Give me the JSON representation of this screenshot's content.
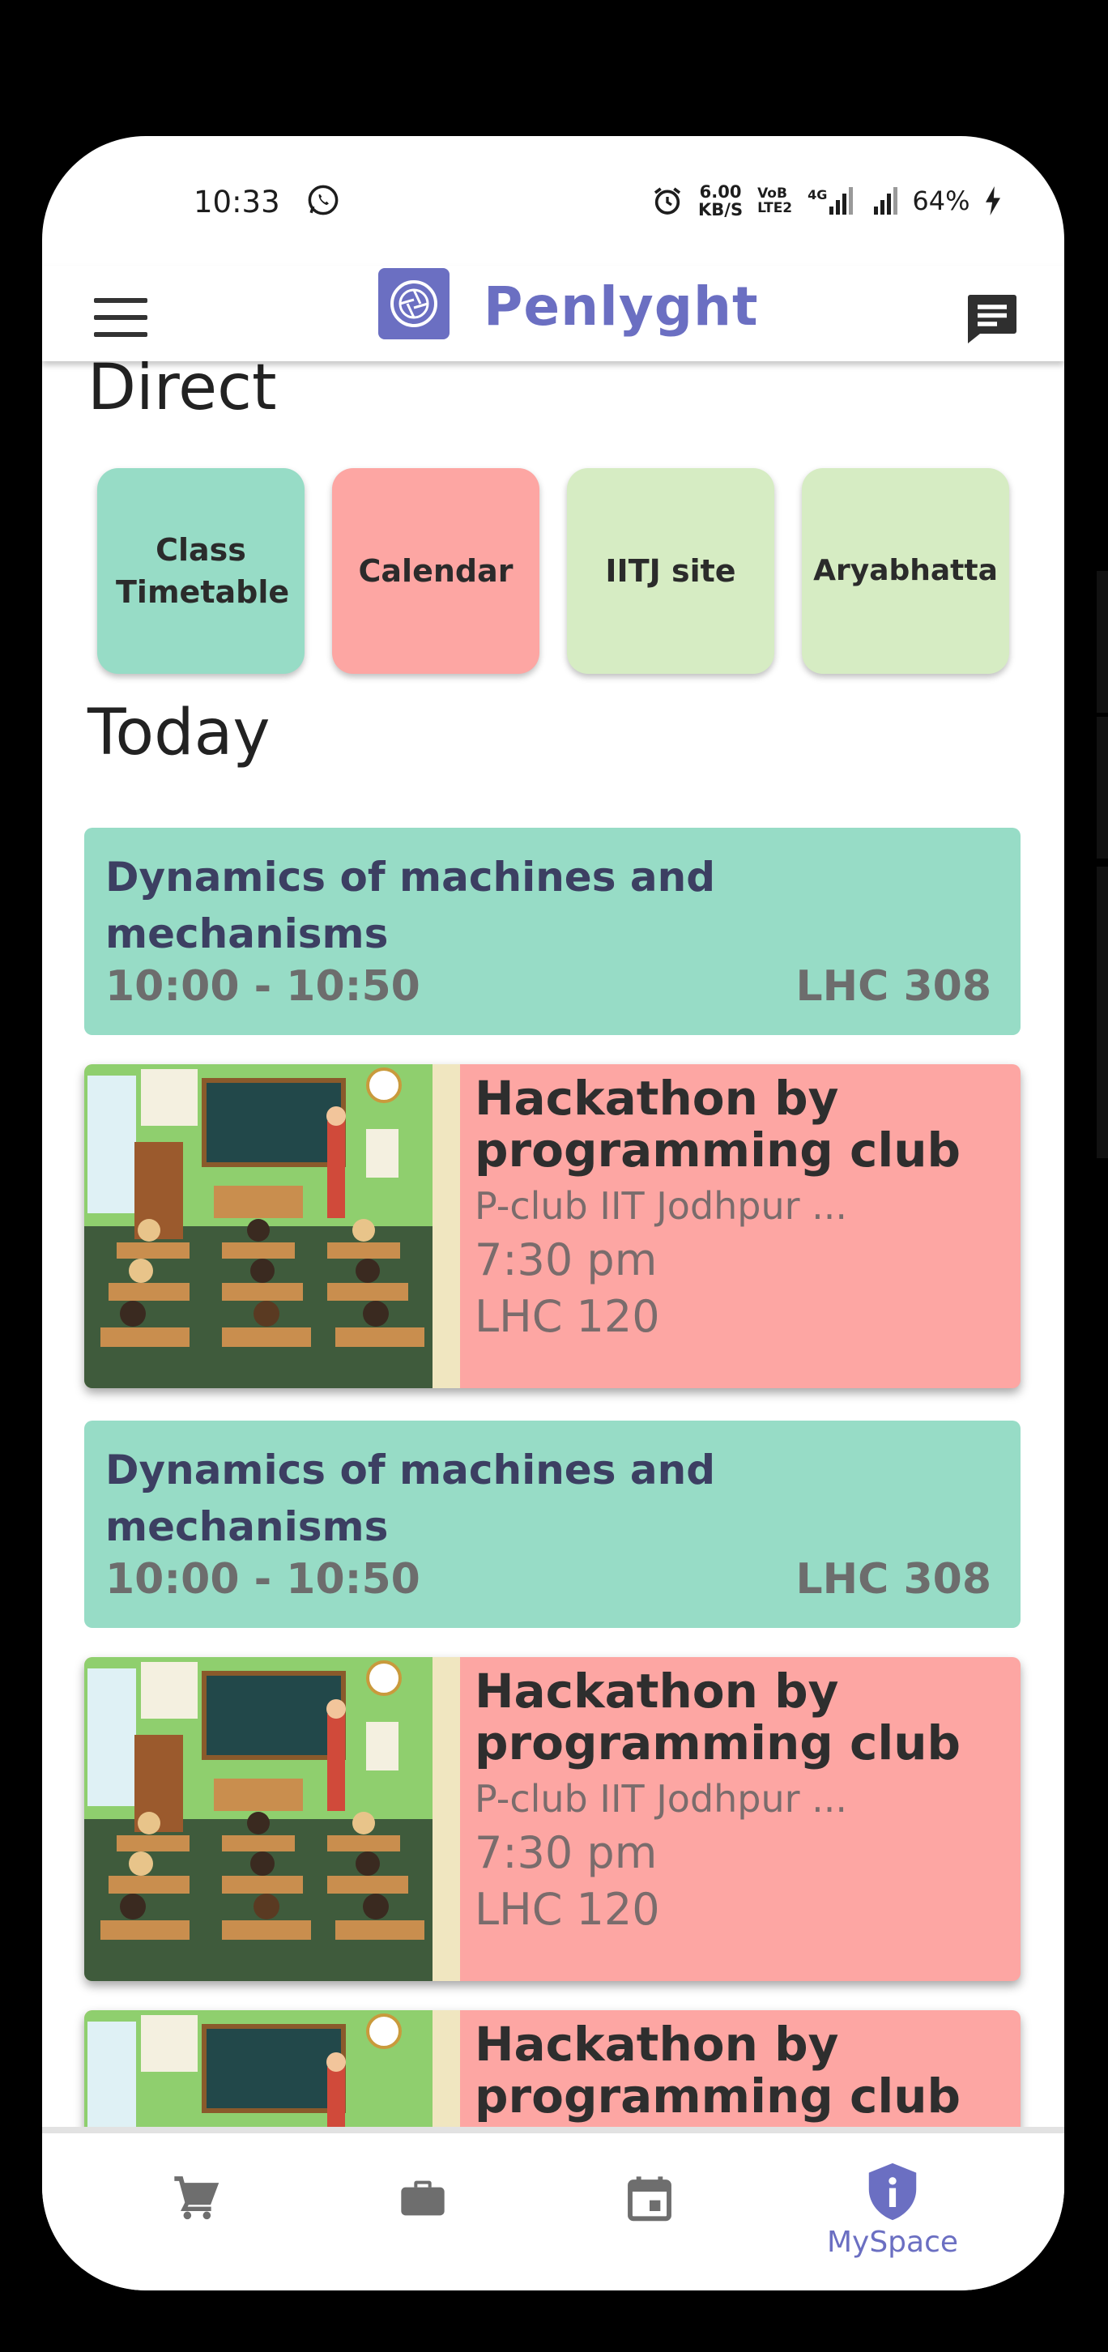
{
  "status_bar": {
    "time": "10:33",
    "speed_value": "6.00",
    "speed_unit": "KB/S",
    "volte": "VoB LTE2",
    "network": "4G",
    "battery": "64%"
  },
  "app_bar": {
    "title": "Penlyght"
  },
  "direct": {
    "title": "Direct",
    "tiles": [
      {
        "label": "Class Timetable",
        "color": "#97dcc6"
      },
      {
        "label": "Calendar",
        "color": "#fda6a3"
      },
      {
        "label": "IITJ site",
        "color": "#d6ecc3"
      },
      {
        "label": "Aryabhatta",
        "color": "#d6ecc3"
      }
    ]
  },
  "today": {
    "title": "Today",
    "classes": [
      {
        "name": "Dynamics of machines and mechanisms",
        "time": "10:00 - 10:50",
        "room": "LHC 308"
      },
      {
        "name": "Dynamics of machines and mechanisms",
        "time": "10:00 - 10:50",
        "room": "LHC 308"
      }
    ],
    "events": [
      {
        "title": "Hackathon by programming club",
        "organizer": "P-club IIT Jodhpur ...",
        "time": "7:30 pm",
        "room": "LHC 120"
      },
      {
        "title": "Hackathon by programming club",
        "organizer": "P-club IIT Jodhpur ...",
        "time": "7:30 pm",
        "room": "LHC 120"
      },
      {
        "title": "Hackathon by programming club"
      }
    ]
  },
  "bottom_nav": {
    "items": [
      {
        "icon": "cart-icon",
        "label": ""
      },
      {
        "icon": "briefcase-icon",
        "label": ""
      },
      {
        "icon": "calendar-icon",
        "label": ""
      },
      {
        "icon": "shield-info-icon",
        "label": "MySpace"
      }
    ],
    "active_color": "#6b6fc2",
    "inactive_color": "#6e6e6e"
  }
}
